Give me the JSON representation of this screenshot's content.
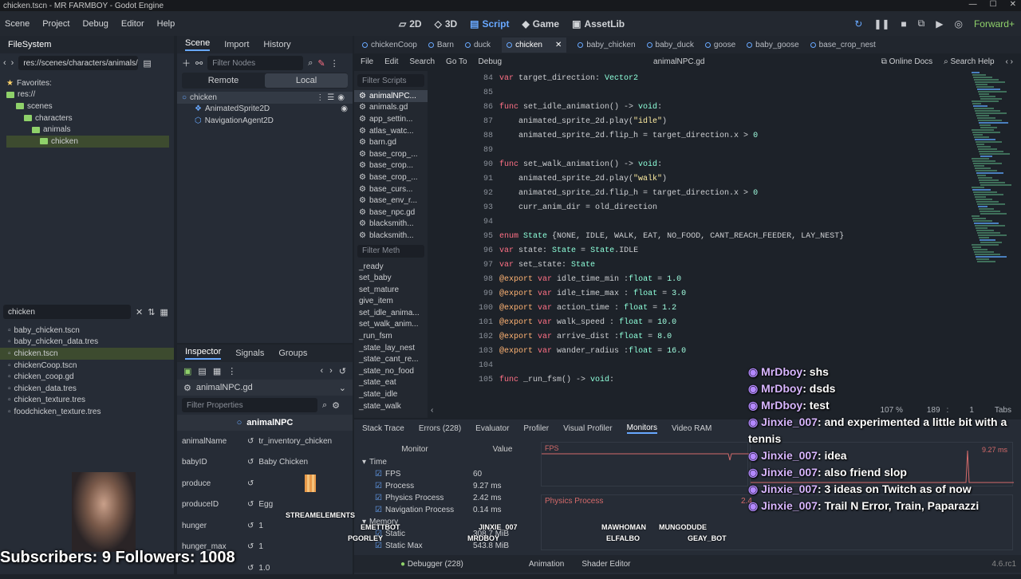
{
  "window": {
    "title": "chicken.tscn - MR FARMBOY - Godot Engine",
    "controls": [
      "—",
      "☐",
      "✕"
    ]
  },
  "menu": [
    "Scene",
    "Project",
    "Debug",
    "Editor",
    "Help"
  ],
  "workspaces": [
    {
      "label": "2D",
      "active": false
    },
    {
      "label": "3D",
      "active": false
    },
    {
      "label": "Script",
      "active": true
    },
    {
      "label": "Game",
      "active": false
    },
    {
      "label": "AssetLib",
      "active": false
    }
  ],
  "topright": {
    "renderer": "Forward+"
  },
  "filesystem": {
    "title": "FileSystem",
    "path": "res://scenes/characters/animals/",
    "favorites": "Favorites:",
    "tree": [
      {
        "label": "res://",
        "level": 0
      },
      {
        "label": "scenes",
        "level": 1
      },
      {
        "label": "characters",
        "level": 2
      },
      {
        "label": "animals",
        "level": 3
      },
      {
        "label": "chicken",
        "level": 4,
        "selected": true
      }
    ],
    "search": "chicken",
    "results": [
      "baby_chicken.tscn",
      "baby_chicken_data.tres",
      "chicken.tscn",
      "chickenCoop.tscn",
      "chicken_coop.gd",
      "chicken_data.tres",
      "chicken_texture.tres",
      "foodchicken_texture.tres"
    ],
    "selected_result": 2
  },
  "scene": {
    "tabs": [
      "Scene",
      "Import",
      "History"
    ],
    "filter_placeholder": "Filter Nodes",
    "remote": "Remote",
    "local": "Local",
    "nodes": [
      {
        "label": "chicken",
        "level": 0
      },
      {
        "label": "AnimatedSprite2D",
        "level": 1
      },
      {
        "label": "NavigationAgent2D",
        "level": 1
      }
    ]
  },
  "inspector": {
    "tabs": [
      "Inspector",
      "Signals",
      "Groups"
    ],
    "resource": "animalNPC.gd",
    "filter_placeholder": "Filter Properties",
    "class": "animalNPC",
    "props": [
      {
        "name": "animalName",
        "value": "tr_inventory_chicken"
      },
      {
        "name": "babyID",
        "value": "Baby Chicken"
      },
      {
        "name": "produce",
        "value": ""
      },
      {
        "name": "produceID",
        "value": "Egg"
      },
      {
        "name": "hunger",
        "value": "1"
      },
      {
        "name": "hunger_max",
        "value": "1"
      },
      {
        "name": "",
        "value": "1.0"
      }
    ]
  },
  "script": {
    "tabs": [
      "chickenCoop",
      "Barn",
      "duck",
      "chicken",
      "baby_chicken",
      "baby_duck",
      "goose",
      "baby_goose",
      "base_crop_nest"
    ],
    "active_tab": 3,
    "menu": [
      "File",
      "Edit",
      "Search",
      "Go To",
      "Debug"
    ],
    "filename": "animalNPC.gd",
    "online_docs": "Online Docs",
    "search_help": "Search Help",
    "filter_scripts": "Filter Scripts",
    "filter_methods": "Filter Meth",
    "scripts": [
      "animalNPC...",
      "animals.gd",
      "app_settin...",
      "atlas_watc...",
      "barn.gd",
      "base_crop_...",
      "base_crop...",
      "base_crop_...",
      "base_curs...",
      "base_env_r...",
      "base_npc.gd",
      "blacksmith...",
      "blacksmith..."
    ],
    "methods": [
      "_ready",
      "set_baby",
      "set_mature",
      "give_item",
      "set_idle_anima...",
      "set_walk_anim...",
      "_run_fsm",
      "_state_lay_nest",
      "_state_cant_re...",
      "_state_no_food",
      "_state_eat",
      "_state_idle",
      "_state_walk"
    ],
    "lines": [
      {
        "n": "84",
        "code": "var target_direction: Vector2"
      },
      {
        "n": "85",
        "code": ""
      },
      {
        "n": "86",
        "code": "func set_idle_animation() -> void:"
      },
      {
        "n": "87",
        "code": "    animated_sprite_2d.play(\"idle\")"
      },
      {
        "n": "88",
        "code": "    animated_sprite_2d.flip_h = target_direction.x > 0"
      },
      {
        "n": "89",
        "code": ""
      },
      {
        "n": "90",
        "code": "func set_walk_animation() -> void:"
      },
      {
        "n": "91",
        "code": "    animated_sprite_2d.play(\"walk\")"
      },
      {
        "n": "92",
        "code": "    animated_sprite_2d.flip_h = target_direction.x > 0"
      },
      {
        "n": "93",
        "code": "    curr_anim_dir = old_direction"
      },
      {
        "n": "94",
        "code": ""
      },
      {
        "n": "95",
        "code": "enum State {NONE, IDLE, WALK, EAT, NO_FOOD, CANT_REACH_FEEDER, LAY_NEST}"
      },
      {
        "n": "96",
        "code": "var state: State = State.IDLE"
      },
      {
        "n": "97",
        "code": "var set_state: State"
      },
      {
        "n": "98",
        "code": "@export var idle_time_min :float = 1.0"
      },
      {
        "n": "99",
        "code": "@export var idle_time_max : float = 3.0"
      },
      {
        "n": "100",
        "code": "@export var action_time : float = 1.2"
      },
      {
        "n": "101",
        "code": "@export var walk_speed : float = 10.0"
      },
      {
        "n": "102",
        "code": "@export var arrive_dist :float = 8.0"
      },
      {
        "n": "103",
        "code": "@export var wander_radius :float = 16.0"
      },
      {
        "n": "104",
        "code": ""
      },
      {
        "n": "105",
        "code": "func _run_fsm() -> void:"
      }
    ],
    "status": {
      "zoom": "107 %",
      "line": "189",
      "col": "1",
      "indent": "Tabs"
    }
  },
  "bottom": {
    "tabs": [
      "Stack Trace",
      "Errors (228)",
      "Evaluator",
      "Profiler",
      "Visual Profiler",
      "Monitors",
      "Video RAM"
    ],
    "active": 5,
    "monitor_hdr": "Monitor",
    "value_hdr": "Value",
    "section": "Time",
    "metrics": [
      {
        "name": "FPS",
        "value": "60"
      },
      {
        "name": "Process",
        "value": "9.27 ms"
      },
      {
        "name": "Physics Process",
        "value": "2.42 ms"
      },
      {
        "name": "Navigation Process",
        "value": "0.14 ms"
      }
    ],
    "memory": "Memory",
    "mem_items": [
      {
        "name": "Static",
        "value": "308.7 MiB"
      },
      {
        "name": "Static Max",
        "value": "543.8 MiB"
      }
    ],
    "graph_fps": "FPS",
    "graph_fps_val": "60",
    "graph_proc_val": "9.27 ms",
    "graph_phys": "Physics Process",
    "graph_phys_val": "2.4",
    "bottom_tabs": [
      "Debugger (228)",
      "Animation",
      "Shader Editor"
    ],
    "version": "4.6.rc1"
  },
  "stream": {
    "subs": "Subscribers: 9 Followers: 1008",
    "streamelements": "STREAMELEMENTS",
    "names": [
      "EMETTBOT",
      "JINXIE_007",
      "PGORLEY",
      "MRDBOY",
      "MAWHOMAN",
      "MUNGODUDE",
      "ELFALBO",
      "GEAY_BOT"
    ]
  },
  "chat": [
    {
      "user": "MrDboy",
      "msg": "shs"
    },
    {
      "user": "MrDboy",
      "msg": "dsds"
    },
    {
      "user": "MrDboy",
      "msg": "test"
    },
    {
      "user": "Jinxie_007",
      "msg": "and experimented a little bit with a tennis"
    },
    {
      "user": "Jinxie_007",
      "msg": "idea"
    },
    {
      "user": "Jinxie_007",
      "msg": "also friend slop"
    },
    {
      "user": "Jinxie_007",
      "msg": "3 ideas on Twitch as of now"
    },
    {
      "user": "Jinxie_007",
      "msg": "Trail N Error, Train, Paparazzi"
    }
  ],
  "colors": {
    "accent": "#68a8ff",
    "folder": "#8fd16a",
    "chat_user": "#d8b6ff"
  }
}
